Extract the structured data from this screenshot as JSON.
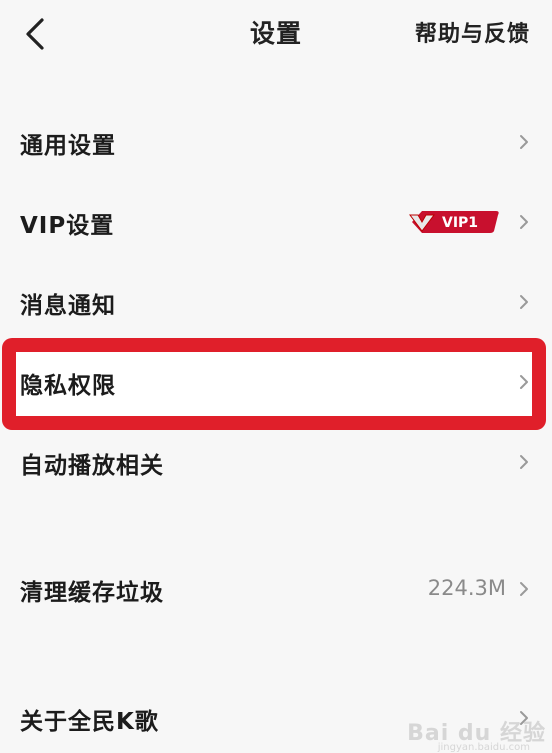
{
  "nav": {
    "title": "设置",
    "help": "帮助与反馈"
  },
  "rows": {
    "general": {
      "label": "通用设置"
    },
    "vip": {
      "label": "VIP设置",
      "badge": "VIP1"
    },
    "notify": {
      "label": "消息通知"
    },
    "privacy": {
      "label": "隐私权限"
    },
    "autoplay": {
      "label": "自动播放相关"
    },
    "cache": {
      "label": "清理缓存垃圾",
      "value": "224.3M"
    },
    "about": {
      "label": "关于全民K歌"
    }
  },
  "colors": {
    "background": "#f7f7f7",
    "highlight": "#e01f2a",
    "vip_badge": "#c8102e"
  },
  "watermark": {
    "brand": "Bai du 经验",
    "url": "jingyan.baidu.com"
  }
}
